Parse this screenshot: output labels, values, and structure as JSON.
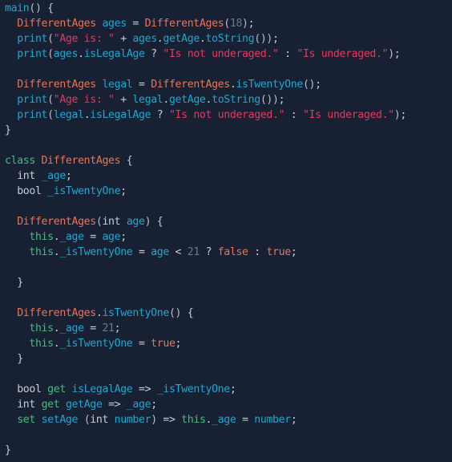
{
  "editor": {
    "language": "dart",
    "colors": {
      "background": "#172133",
      "function": "#1ea7cf",
      "class": "#e97556",
      "variable": "#1ea7cf",
      "string": "#e5385f",
      "number": "#6a7a87",
      "keyword": "#3fbf7a",
      "boolean": "#e97556",
      "type": "#c9cdd4",
      "punctuation": "#c9cdd4"
    },
    "lines": [
      [
        [
          "fn",
          "main"
        ],
        [
          "paren",
          "()"
        ],
        [
          "punc",
          " {"
        ]
      ],
      [
        [
          "plain",
          "  "
        ],
        [
          "cls",
          "DifferentAges"
        ],
        [
          "plain",
          " "
        ],
        [
          "var",
          "ages"
        ],
        [
          "punc",
          " = "
        ],
        [
          "cls",
          "DifferentAges"
        ],
        [
          "paren",
          "("
        ],
        [
          "num",
          "18"
        ],
        [
          "paren",
          ")"
        ],
        [
          "punc",
          ";"
        ]
      ],
      [
        [
          "plain",
          "  "
        ],
        [
          "fn",
          "print"
        ],
        [
          "paren",
          "("
        ],
        [
          "str",
          "\"Age is: \""
        ],
        [
          "punc",
          " + "
        ],
        [
          "var",
          "ages"
        ],
        [
          "punc",
          "."
        ],
        [
          "var",
          "getAge"
        ],
        [
          "punc",
          "."
        ],
        [
          "fn",
          "toString"
        ],
        [
          "paren",
          "())"
        ],
        [
          "punc",
          ";"
        ]
      ],
      [
        [
          "plain",
          "  "
        ],
        [
          "fn",
          "print"
        ],
        [
          "paren",
          "("
        ],
        [
          "var",
          "ages"
        ],
        [
          "punc",
          "."
        ],
        [
          "var",
          "isLegalAge"
        ],
        [
          "punc",
          " ? "
        ],
        [
          "str",
          "\"Is not underaged.\""
        ],
        [
          "punc",
          " : "
        ],
        [
          "str",
          "\"Is underaged.\""
        ],
        [
          "paren",
          ")"
        ],
        [
          "punc",
          ";"
        ]
      ],
      [],
      [
        [
          "plain",
          "  "
        ],
        [
          "cls",
          "DifferentAges"
        ],
        [
          "plain",
          " "
        ],
        [
          "var",
          "legal"
        ],
        [
          "punc",
          " = "
        ],
        [
          "cls",
          "DifferentAges"
        ],
        [
          "punc",
          "."
        ],
        [
          "fn",
          "isTwentyOne"
        ],
        [
          "paren",
          "()"
        ],
        [
          "punc",
          ";"
        ]
      ],
      [
        [
          "plain",
          "  "
        ],
        [
          "fn",
          "print"
        ],
        [
          "paren",
          "("
        ],
        [
          "str",
          "\"Age is: \""
        ],
        [
          "punc",
          " + "
        ],
        [
          "var",
          "legal"
        ],
        [
          "punc",
          "."
        ],
        [
          "var",
          "getAge"
        ],
        [
          "punc",
          "."
        ],
        [
          "fn",
          "toString"
        ],
        [
          "paren",
          "())"
        ],
        [
          "punc",
          ";"
        ]
      ],
      [
        [
          "plain",
          "  "
        ],
        [
          "fn",
          "print"
        ],
        [
          "paren",
          "("
        ],
        [
          "var",
          "legal"
        ],
        [
          "punc",
          "."
        ],
        [
          "var",
          "isLegalAge"
        ],
        [
          "punc",
          " ? "
        ],
        [
          "str",
          "\"Is not underaged.\""
        ],
        [
          "punc",
          " : "
        ],
        [
          "str",
          "\"Is underaged.\""
        ],
        [
          "paren",
          ")"
        ],
        [
          "punc",
          ";"
        ]
      ],
      [
        [
          "punc",
          "}"
        ]
      ],
      [],
      [
        [
          "kw",
          "class"
        ],
        [
          "plain",
          " "
        ],
        [
          "cls",
          "DifferentAges"
        ],
        [
          "punc",
          " {"
        ]
      ],
      [
        [
          "plain",
          "  "
        ],
        [
          "type",
          "int"
        ],
        [
          "plain",
          " "
        ],
        [
          "var",
          "_age"
        ],
        [
          "punc",
          ";"
        ]
      ],
      [
        [
          "plain",
          "  "
        ],
        [
          "type",
          "bool"
        ],
        [
          "plain",
          " "
        ],
        [
          "var",
          "_isTwentyOne"
        ],
        [
          "punc",
          ";"
        ]
      ],
      [],
      [
        [
          "plain",
          "  "
        ],
        [
          "cls",
          "DifferentAges"
        ],
        [
          "paren",
          "("
        ],
        [
          "type",
          "int"
        ],
        [
          "plain",
          " "
        ],
        [
          "var",
          "age"
        ],
        [
          "paren",
          ")"
        ],
        [
          "punc",
          " {"
        ]
      ],
      [
        [
          "plain",
          "    "
        ],
        [
          "kw",
          "this"
        ],
        [
          "punc",
          "."
        ],
        [
          "var",
          "_age"
        ],
        [
          "punc",
          " = "
        ],
        [
          "var",
          "age"
        ],
        [
          "punc",
          ";"
        ]
      ],
      [
        [
          "plain",
          "    "
        ],
        [
          "kw",
          "this"
        ],
        [
          "punc",
          "."
        ],
        [
          "var",
          "_isTwentyOne"
        ],
        [
          "punc",
          " = "
        ],
        [
          "var",
          "age"
        ],
        [
          "punc",
          " < "
        ],
        [
          "num",
          "21"
        ],
        [
          "punc",
          " ? "
        ],
        [
          "bool",
          "false"
        ],
        [
          "punc",
          " : "
        ],
        [
          "bool",
          "true"
        ],
        [
          "punc",
          ";"
        ]
      ],
      [],
      [
        [
          "plain",
          "  "
        ],
        [
          "punc",
          "}"
        ]
      ],
      [],
      [
        [
          "plain",
          "  "
        ],
        [
          "cls",
          "DifferentAges"
        ],
        [
          "punc",
          "."
        ],
        [
          "fn",
          "isTwentyOne"
        ],
        [
          "paren",
          "()"
        ],
        [
          "punc",
          " {"
        ]
      ],
      [
        [
          "plain",
          "    "
        ],
        [
          "kw",
          "this"
        ],
        [
          "punc",
          "."
        ],
        [
          "var",
          "_age"
        ],
        [
          "punc",
          " = "
        ],
        [
          "num",
          "21"
        ],
        [
          "punc",
          ";"
        ]
      ],
      [
        [
          "plain",
          "    "
        ],
        [
          "kw",
          "this"
        ],
        [
          "punc",
          "."
        ],
        [
          "var",
          "_isTwentyOne"
        ],
        [
          "punc",
          " = "
        ],
        [
          "bool",
          "true"
        ],
        [
          "punc",
          ";"
        ]
      ],
      [
        [
          "plain",
          "  "
        ],
        [
          "punc",
          "}"
        ]
      ],
      [],
      [
        [
          "plain",
          "  "
        ],
        [
          "type",
          "bool"
        ],
        [
          "plain",
          " "
        ],
        [
          "kw",
          "get"
        ],
        [
          "plain",
          " "
        ],
        [
          "var",
          "isLegalAge"
        ],
        [
          "punc",
          " => "
        ],
        [
          "var",
          "_isTwentyOne"
        ],
        [
          "punc",
          ";"
        ]
      ],
      [
        [
          "plain",
          "  "
        ],
        [
          "type",
          "int"
        ],
        [
          "plain",
          " "
        ],
        [
          "kw",
          "get"
        ],
        [
          "plain",
          " "
        ],
        [
          "var",
          "getAge"
        ],
        [
          "punc",
          " => "
        ],
        [
          "var",
          "_age"
        ],
        [
          "punc",
          ";"
        ]
      ],
      [
        [
          "plain",
          "  "
        ],
        [
          "kw",
          "set"
        ],
        [
          "plain",
          " "
        ],
        [
          "var",
          "setAge"
        ],
        [
          "plain",
          " "
        ],
        [
          "paren",
          "("
        ],
        [
          "type",
          "int"
        ],
        [
          "plain",
          " "
        ],
        [
          "var",
          "number"
        ],
        [
          "paren",
          ")"
        ],
        [
          "punc",
          " => "
        ],
        [
          "kw",
          "this"
        ],
        [
          "punc",
          "."
        ],
        [
          "var",
          "_age"
        ],
        [
          "punc",
          " = "
        ],
        [
          "var",
          "number"
        ],
        [
          "punc",
          ";"
        ]
      ],
      [],
      [
        [
          "punc",
          "}"
        ]
      ]
    ]
  }
}
